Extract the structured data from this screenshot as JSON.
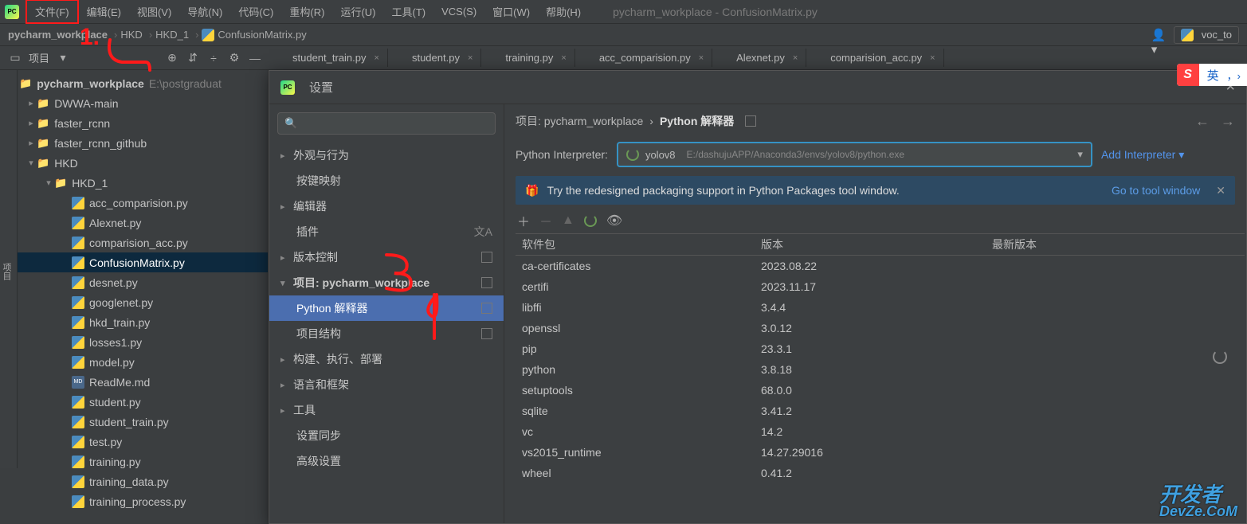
{
  "menubar": {
    "items": [
      "文件(F)",
      "编辑(E)",
      "视图(V)",
      "导航(N)",
      "代码(C)",
      "重构(R)",
      "运行(U)",
      "工具(T)",
      "VCS(S)",
      "窗口(W)",
      "帮助(H)"
    ],
    "title": "pycharm_workplace - ConfusionMatrix.py"
  },
  "breadcrumb": {
    "project": "pycharm_workplace",
    "parts": [
      "HKD",
      "HKD_1"
    ],
    "file": "ConfusionMatrix.py",
    "interpreter_chip": "voc_to"
  },
  "project_panel": {
    "title": "项目",
    "path_hint": "E:\\postgraduat"
  },
  "tree": [
    {
      "d": 0,
      "type": "root",
      "label": "pycharm_workplace",
      "hint": "E:\\postgraduat",
      "open": true
    },
    {
      "d": 1,
      "type": "folder",
      "label": "DWWA-main"
    },
    {
      "d": 1,
      "type": "folder",
      "label": "faster_rcnn"
    },
    {
      "d": 1,
      "type": "folder",
      "label": "faster_rcnn_github"
    },
    {
      "d": 1,
      "type": "folder",
      "label": "HKD",
      "open": true
    },
    {
      "d": 2,
      "type": "folder",
      "label": "HKD_1",
      "open": true
    },
    {
      "d": 3,
      "type": "py",
      "label": "acc_comparision.py"
    },
    {
      "d": 3,
      "type": "py",
      "label": "Alexnet.py"
    },
    {
      "d": 3,
      "type": "py",
      "label": "comparision_acc.py"
    },
    {
      "d": 3,
      "type": "py",
      "label": "ConfusionMatrix.py",
      "selected": true
    },
    {
      "d": 3,
      "type": "py",
      "label": "desnet.py"
    },
    {
      "d": 3,
      "type": "py",
      "label": "googlenet.py"
    },
    {
      "d": 3,
      "type": "py",
      "label": "hkd_train.py"
    },
    {
      "d": 3,
      "type": "py",
      "label": "losses1.py"
    },
    {
      "d": 3,
      "type": "py",
      "label": "model.py"
    },
    {
      "d": 3,
      "type": "md",
      "label": "ReadMe.md"
    },
    {
      "d": 3,
      "type": "py",
      "label": "student.py"
    },
    {
      "d": 3,
      "type": "py",
      "label": "student_train.py"
    },
    {
      "d": 3,
      "type": "py",
      "label": "test.py"
    },
    {
      "d": 3,
      "type": "py",
      "label": "training.py"
    },
    {
      "d": 3,
      "type": "py",
      "label": "training_data.py"
    },
    {
      "d": 3,
      "type": "py",
      "label": "training_process.py"
    }
  ],
  "tabs": [
    {
      "label": "student_train.py"
    },
    {
      "label": "student.py"
    },
    {
      "label": "training.py"
    },
    {
      "label": "acc_comparision.py"
    },
    {
      "label": "Alexnet.py"
    },
    {
      "label": "comparision_acc.py"
    }
  ],
  "settings": {
    "dialog_title": "设置",
    "search_placeholder": "Q",
    "nav": [
      {
        "label": "外观与行为",
        "chev": true
      },
      {
        "label": "按键映射",
        "sub": true
      },
      {
        "label": "编辑器",
        "chev": true
      },
      {
        "label": "插件",
        "sub": true,
        "lang": true
      },
      {
        "label": "版本控制",
        "chev": true,
        "box": true
      },
      {
        "label": "项目: pycharm_workplace",
        "chev": true,
        "open": true,
        "bold": true,
        "box": true
      },
      {
        "label": "Python 解释器",
        "sub": true,
        "selected": true,
        "box": true
      },
      {
        "label": "项目结构",
        "sub": true,
        "box": true
      },
      {
        "label": "构建、执行、部署",
        "chev": true
      },
      {
        "label": "语言和框架",
        "chev": true
      },
      {
        "label": "工具",
        "chev": true
      },
      {
        "label": "设置同步",
        "sub": true
      },
      {
        "label": "高级设置",
        "sub": true
      }
    ],
    "bc_project": "项目: pycharm_workplace",
    "bc_page": "Python 解释器",
    "interpreter_label": "Python Interpreter:",
    "interpreter_name": "yolov8",
    "interpreter_path": "E:/dashujuAPP/Anaconda3/envs/yolov8/python.exe",
    "add_interpreter": "Add Interpreter",
    "banner_text": "Try the redesigned packaging support in Python Packages tool window.",
    "banner_link": "Go to tool window",
    "table_headers": {
      "c1": "软件包",
      "c2": "版本",
      "c3": "最新版本"
    },
    "packages": [
      {
        "name": "ca-certificates",
        "ver": "2023.08.22"
      },
      {
        "name": "certifi",
        "ver": "2023.11.17"
      },
      {
        "name": "libffi",
        "ver": "3.4.4"
      },
      {
        "name": "openssl",
        "ver": "3.0.12"
      },
      {
        "name": "pip",
        "ver": "23.3.1"
      },
      {
        "name": "python",
        "ver": "3.8.18"
      },
      {
        "name": "setuptools",
        "ver": "68.0.0"
      },
      {
        "name": "sqlite",
        "ver": "3.41.2"
      },
      {
        "name": "vc",
        "ver": "14.2"
      },
      {
        "name": "vs2015_runtime",
        "ver": "14.27.29016"
      },
      {
        "name": "wheel",
        "ver": "0.41.2"
      }
    ]
  },
  "ime": {
    "s": "S",
    "t": "英"
  },
  "watermark": {
    "l1": "开发者",
    "l2": "DevZe.CoM"
  }
}
